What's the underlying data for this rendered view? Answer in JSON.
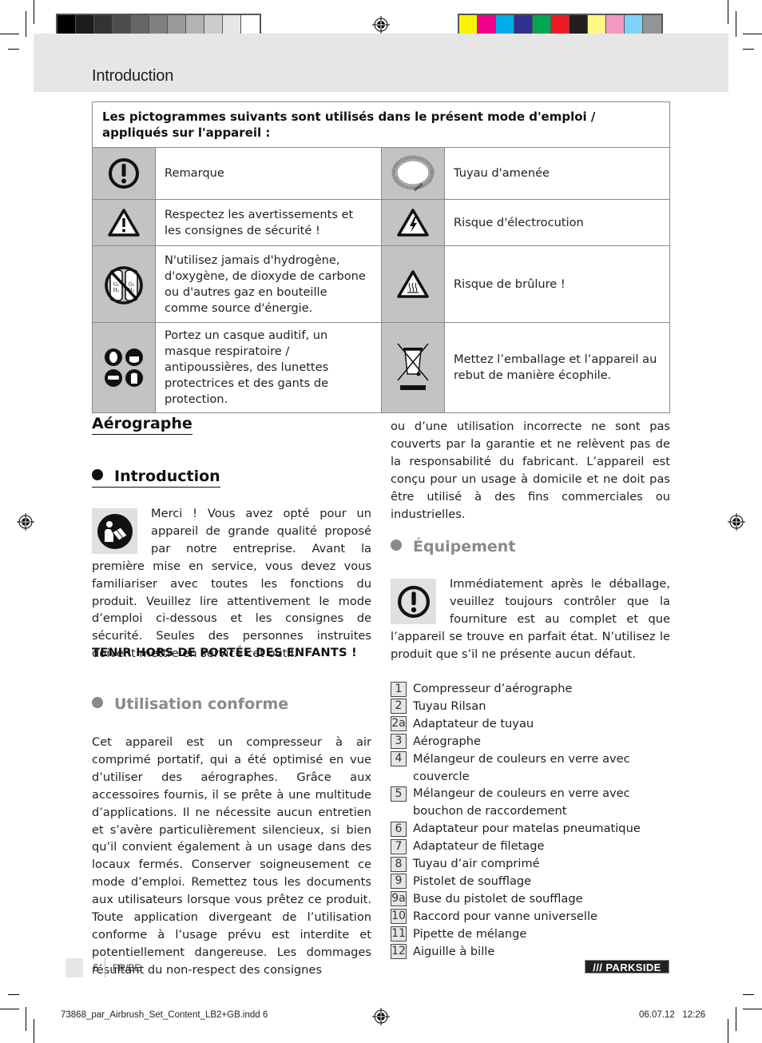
{
  "print_marks": {
    "grayscale_swatches": [
      "#000000",
      "#1c1c1c",
      "#333333",
      "#4d4d4d",
      "#666666",
      "#808080",
      "#999999",
      "#b3b3b3",
      "#cccccc",
      "#e6e6e6",
      "#ffffff"
    ],
    "color_swatches": [
      "#fff200",
      "#ec008c",
      "#00aeef",
      "#2e3192",
      "#00a651",
      "#ed1c24",
      "#231f20",
      "#fff685",
      "#f49ac1",
      "#7dd3f7",
      "#939598"
    ]
  },
  "header": {
    "title": "Introduction"
  },
  "pictograms": {
    "heading": "Les pictogrammes suivants sont utilisés dans le présent mode d'emploi / appliqués sur l'appareil :",
    "rows": [
      {
        "left": {
          "icon": "exclamation-circle-icon",
          "text": "Remarque"
        },
        "right": {
          "icon": "coiled-hose-icon",
          "text": "Tuyau d'amenée"
        }
      },
      {
        "left": {
          "icon": "warning-triangle-icon",
          "text": "Respectez les avertissements et les consignes de sécurité !"
        },
        "right": {
          "icon": "electric-shock-icon",
          "text": "Risque d'électrocution"
        }
      },
      {
        "left": {
          "icon": "no-gas-bottles-icon",
          "text": "N'utilisez jamais d'hydrogène, d'oxygène, de dioxyde de carbone ou d'autres gaz en bouteille comme source d'énergie."
        },
        "right": {
          "icon": "hot-surface-icon",
          "text": "Risque de brûlure !"
        }
      },
      {
        "left": {
          "icon": "protective-equipment-icon",
          "text": "Portez un casque auditif, un masque respiratoire / antipoussières, des lunettes protectrices et des gants de protection."
        },
        "right": {
          "icon": "crossed-bin-icon",
          "text": "Mettez l’emballage et l’appareil au rebut de manière écophile."
        }
      }
    ]
  },
  "sections": {
    "product_title": "Aérographe",
    "intro": {
      "heading": "Introduction",
      "icon": "read-manual-icon",
      "body": "Merci ! Vous avez opté pour un appareil de grande qualité proposé par notre entreprise. Avant la première mise en service, vous devez vous familiariser avec toutes les fonctions du produit. Veuillez lire attentivement le mode d’emploi ci-dessous et les consignes de sécurité. Seules des personnes instruites doivent mettre en service cet outil.",
      "warning": "TENIR HORS DE PORTÉE DES ENFANTS !"
    },
    "intended_use": {
      "heading": "Utilisation conforme",
      "body": "Cet appareil est un compresseur à air comprimé portatif, qui a été optimisé en vue d’utiliser des aérographes. Grâce aux accessoires fournis, il se prête à une multitude d’applications. Il ne nécessite aucun entretien et s’avère particulièrement silencieux, si bien qu’il convient également à un usage dans des locaux fermés. Conserver soigneusement ce mode d’emploi. Remettez tous les documents aux utilisateurs lorsque vous prêtez ce produit. Toute application divergeant de l’utilisation conforme à l’usage prévu est interdite et potentiellement dangereuse. Les dommages résultant du non-respect des consignes",
      "body_cont": "ou d’une utilisation incorrecte ne sont pas couverts par la garantie et ne relèvent pas de la responsabilité du fabricant. L’appareil est conçu pour un usage à domicile et ne doit pas être utilisé à des fins commerciales ou industrielles."
    },
    "equipment": {
      "heading": "Équipement",
      "icon": "exclamation-circle-icon",
      "body": "Immédiatement après le déballage, veuillez toujours contrôler que la fourniture est au complet et que l’appareil se trouve en parfait état. N’utilisez le produit que s’il ne présente aucun défaut.",
      "parts": [
        {
          "num": "1",
          "label": "Compresseur d’aérographe"
        },
        {
          "num": "2",
          "label": "Tuyau Rilsan"
        },
        {
          "num": "2a",
          "label": "Adaptateur de tuyau"
        },
        {
          "num": "3",
          "label": "Aérographe"
        },
        {
          "num": "4",
          "label": "Mélangeur de couleurs en verre avec couvercle"
        },
        {
          "num": "5",
          "label": "Mélangeur de couleurs en verre avec bouchon de raccordement"
        },
        {
          "num": "6",
          "label": "Adaptateur pour matelas pneumatique"
        },
        {
          "num": "7",
          "label": "Adaptateur de filetage"
        },
        {
          "num": "8",
          "label": "Tuyau d’air comprimé"
        },
        {
          "num": "9",
          "label": "Pistolet de soufflage"
        },
        {
          "num": "9a",
          "label": "Buse du pistolet de soufflage"
        },
        {
          "num": "10",
          "label": "Raccord pour vanne universelle"
        },
        {
          "num": "11",
          "label": "Pipette de mélange"
        },
        {
          "num": "12",
          "label": "Aiguille à bille"
        }
      ]
    }
  },
  "footer": {
    "page_number": "6",
    "language": "FR/BE",
    "brand": "/// PARKSIDE"
  },
  "slug": {
    "file": "73868_par_Airbrush_Set_Content_LB2+GB.indd   6",
    "datetime": "06.07.12   12:26"
  }
}
